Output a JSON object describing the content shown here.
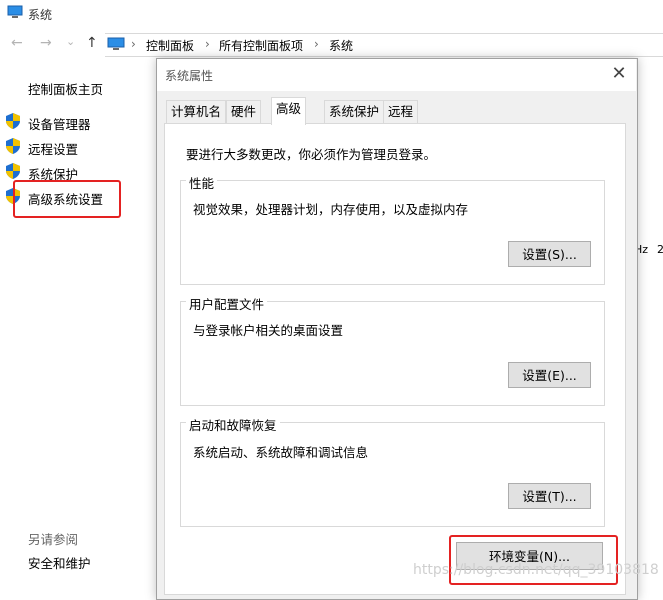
{
  "window": {
    "title": "系统"
  },
  "nav": {
    "back": "←",
    "forward": "→",
    "dropdown": "⌄",
    "up": "↑",
    "breadcrumb": [
      "控制面板",
      "所有控制面板项",
      "系统"
    ],
    "separator": "›"
  },
  "left": {
    "home": "控制面板主页",
    "items": [
      {
        "label": "设备管理器",
        "icon": "uac-shield-icon"
      },
      {
        "label": "远程设置",
        "icon": "uac-shield-icon"
      },
      {
        "label": "系统保护",
        "icon": "uac-shield-icon"
      },
      {
        "label": "高级系统设置",
        "icon": "uac-shield-icon"
      }
    ],
    "see_also_title": "另请参阅",
    "see_also_items": [
      "安全和维护"
    ]
  },
  "background": {
    "fragment1": "Hz",
    "fragment2": "2"
  },
  "dialog": {
    "title": "系统属性",
    "close": "✕",
    "tabs": [
      {
        "label": "计算机名",
        "active": false
      },
      {
        "label": "硬件",
        "active": false
      },
      {
        "label": "高级",
        "active": true
      },
      {
        "label": "系统保护",
        "active": false
      },
      {
        "label": "远程",
        "active": false
      }
    ],
    "admin_note": "要进行大多数更改，你必须作为管理员登录。",
    "groups": {
      "performance": {
        "title": "性能",
        "desc": "视觉效果，处理器计划，内存使用，以及虚拟内存",
        "button": "设置(S)..."
      },
      "profiles": {
        "title": "用户配置文件",
        "desc": "与登录帐户相关的桌面设置",
        "button": "设置(E)..."
      },
      "startup": {
        "title": "启动和故障恢复",
        "desc": "系统启动、系统故障和调试信息",
        "button": "设置(T)..."
      }
    },
    "env_button": "环境变量(N)..."
  },
  "watermark": "https://blog.csdn.net/qq_39103818",
  "colors": {
    "highlight": "#e42222",
    "shield_blue": "#1e6fd0",
    "shield_yellow": "#f2c200"
  }
}
